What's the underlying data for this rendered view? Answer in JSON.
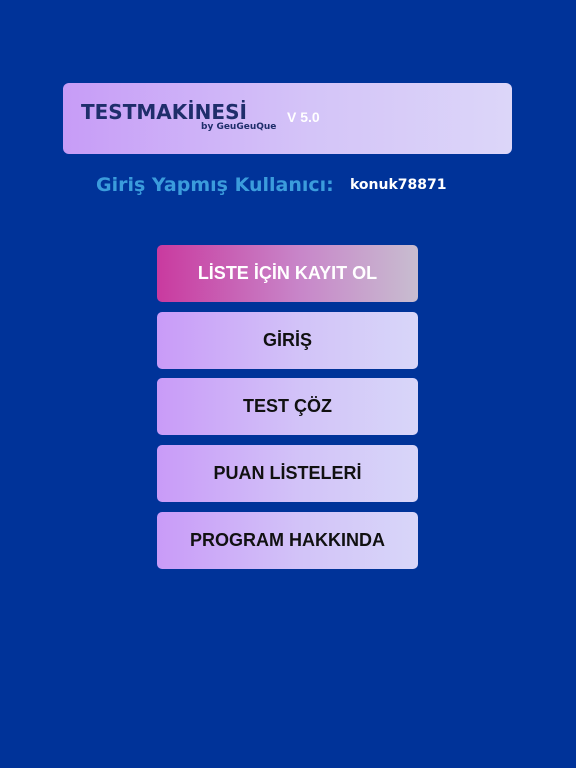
{
  "header": {
    "logo_text": "TESTMAKİNESİ",
    "logo_byline": "by GeuGeuQue",
    "version": "V 5.0"
  },
  "user": {
    "label": "Giriş Yapmış Kullanıcı:",
    "username": "konuk78871"
  },
  "menu": {
    "items": [
      {
        "label": "LİSTE İÇİN KAYIT OL",
        "active": true
      },
      {
        "label": "GİRİŞ",
        "active": false
      },
      {
        "label": "TEST ÇÖZ",
        "active": false
      },
      {
        "label": "PUAN LİSTELERİ",
        "active": false
      },
      {
        "label": "PROGRAM HAKKINDA",
        "active": false
      }
    ]
  },
  "colors": {
    "background": "#003399",
    "user_label": "#3b9cdc",
    "active_button": "#c93a9f",
    "button": "#c99bf8",
    "logo": "#1f2e6b"
  }
}
